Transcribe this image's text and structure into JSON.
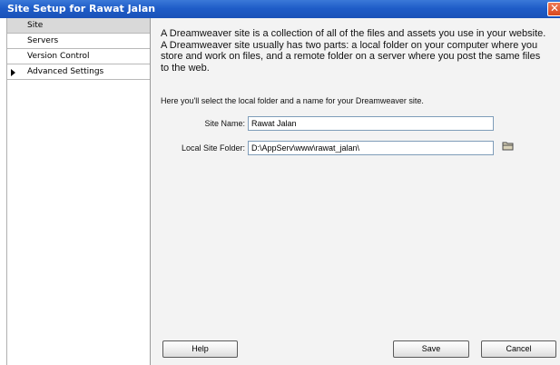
{
  "window": {
    "title": "Site Setup for Rawat Jalan"
  },
  "sidebar": {
    "items": [
      {
        "label": "Site"
      },
      {
        "label": "Servers"
      },
      {
        "label": "Version Control"
      },
      {
        "label": "Advanced Settings"
      }
    ]
  },
  "main": {
    "description": "A Dreamweaver site is a collection of all of the files and assets you use in your website. A Dreamweaver site usually has two parts: a local folder on your computer where you store and work on files, and a remote folder on a server where you post the same files to the web.",
    "hint": "Here you'll select the local folder and a name for your Dreamweaver site.",
    "site_name": {
      "label": "Site Name:",
      "value": "Rawat Jalan"
    },
    "local_folder": {
      "label": "Local Site Folder:",
      "value": "D:\\AppServ\\www\\rawat_jalan\\"
    }
  },
  "buttons": {
    "help": "Help",
    "save": "Save",
    "cancel": "Cancel"
  },
  "colors": {
    "titlebar": "#1f5dc8",
    "close": "#d8481e",
    "selected_item": "#d9d9d9"
  },
  "icons": {
    "folder": "folder-icon",
    "close": "close-icon",
    "expand": "chevron-right-icon"
  }
}
